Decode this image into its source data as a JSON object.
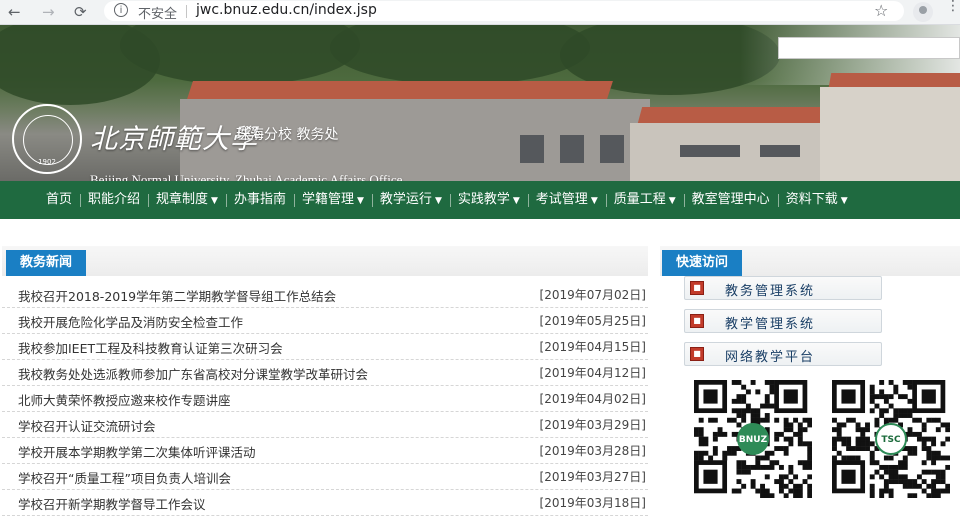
{
  "browser": {
    "back": "←",
    "forward": "→",
    "reload": "⟳",
    "security_label": "不安全",
    "url": "jwc.bnuz.edu.cn/index.jsp",
    "bookmark_icon": "star-icon",
    "menu_icon": "kebab-icon"
  },
  "header": {
    "brand_cn": "北京師範大學",
    "brand_sub": "珠海分校   教务处",
    "brand_en": "Beijing Normal University, Zhuhai  Academic Affairs Office",
    "seal_text": "BEIJING NORMAL UNIVERSITY",
    "seal_year": "1902"
  },
  "nav": [
    {
      "label": "首页",
      "dropdown": false
    },
    {
      "label": "职能介绍",
      "dropdown": false
    },
    {
      "label": "规章制度",
      "dropdown": true
    },
    {
      "label": "办事指南",
      "dropdown": false
    },
    {
      "label": "学籍管理",
      "dropdown": true
    },
    {
      "label": "教学运行",
      "dropdown": true
    },
    {
      "label": "实践教学",
      "dropdown": true
    },
    {
      "label": "考试管理",
      "dropdown": true
    },
    {
      "label": "质量工程",
      "dropdown": true
    },
    {
      "label": "教室管理中心",
      "dropdown": false
    },
    {
      "label": "资料下载",
      "dropdown": true
    }
  ],
  "news": {
    "heading": "教务新闻",
    "items": [
      {
        "title": "我校召开2018-2019学年第二学期教学督导组工作总结会",
        "date": "[2019年07月02日]"
      },
      {
        "title": "我校开展危险化学品及消防安全检查工作",
        "date": "[2019年05月25日]"
      },
      {
        "title": "我校参加IEET工程及科技教育认证第三次研习会",
        "date": "[2019年04月15日]"
      },
      {
        "title": "我校教务处处选派教师参加广东省高校对分课堂教学改革研讨会",
        "date": "[2019年04月12日]"
      },
      {
        "title": "北师大黄荣怀教授应邀来校作专题讲座",
        "date": "[2019年04月02日]"
      },
      {
        "title": "学校召开认证交流研讨会",
        "date": "[2019年03月29日]"
      },
      {
        "title": "学校开展本学期教学第二次集体听评课活动",
        "date": "[2019年03月28日]"
      },
      {
        "title": "学校召开“质量工程”项目负责人培训会",
        "date": "[2019年03月27日]"
      },
      {
        "title": "学校召开新学期教学督导工作会议",
        "date": "[2019年03月18日]"
      }
    ]
  },
  "quick": {
    "heading": "快速访问",
    "links": [
      {
        "label": "教务管理系统"
      },
      {
        "label": "教学管理系统"
      },
      {
        "label": "网络教学平台"
      }
    ],
    "qr_badges": [
      "BNUZ",
      "TSC"
    ]
  },
  "colors": {
    "nav_green": "#1f6a40",
    "tab_blue": "#1a7fc4"
  }
}
